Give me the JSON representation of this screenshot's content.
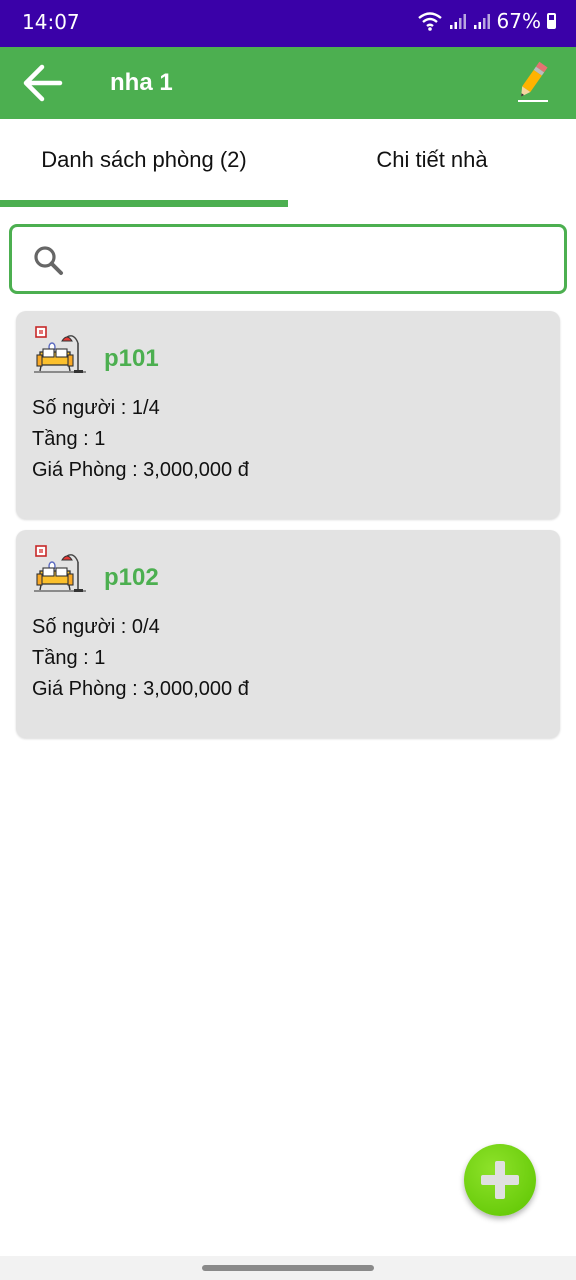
{
  "status_bar": {
    "time": "14:07",
    "battery_percent": "67%",
    "icons": [
      "wifi-icon",
      "signal-icon",
      "signal-icon",
      "battery-icon"
    ]
  },
  "app_bar": {
    "title": "nha 1",
    "back_icon": "arrow-left-icon",
    "edit_icon": "pencil-icon",
    "background": "#4caf50"
  },
  "tabs": [
    {
      "label": "Danh sách phòng (2)",
      "selected": true
    },
    {
      "label": "Chi tiết nhà",
      "selected": false
    }
  ],
  "search": {
    "placeholder": "",
    "value": "",
    "icon": "search-icon"
  },
  "rooms": [
    {
      "name": "p101",
      "occupancy": "Số người : 1/4",
      "floor": "Tầng : 1",
      "price": "Giá Phòng : 3,000,000 đ",
      "icon": "living-room-icon"
    },
    {
      "name": "p102",
      "occupancy": "Số người : 0/4",
      "floor": "Tầng : 1",
      "price": "Giá Phòng : 3,000,000 đ",
      "icon": "living-room-icon"
    }
  ],
  "fab": {
    "icon": "plus-icon",
    "color": "#6fd40f"
  },
  "colors": {
    "accent": "#4caf50",
    "status_bar": "#3a01a8",
    "card": "#e3e3e3"
  }
}
